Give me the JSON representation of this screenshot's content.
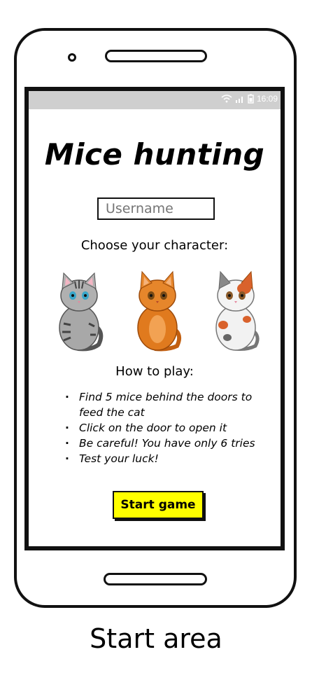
{
  "app": {
    "title": "Mice hunting",
    "status_time": "16:09",
    "username_placeholder": "Username",
    "choose_label": "Choose your character:",
    "characters": [
      {
        "icon": "grey-tabby-cat-icon",
        "color": "#9a9a9a"
      },
      {
        "icon": "orange-cat-icon",
        "color": "#e07a1e"
      },
      {
        "icon": "calico-cat-icon",
        "color": "#f0f0f0"
      }
    ],
    "how_to_play_label": "How to play:",
    "rules": [
      "Find 5 mice behind the doors to feed the cat",
      "Click on the door to open it",
      "Be careful! You have only 6 tries",
      "Test your luck!"
    ],
    "start_button": "Start game",
    "button_color": "#ffff00"
  },
  "caption": "Start area"
}
